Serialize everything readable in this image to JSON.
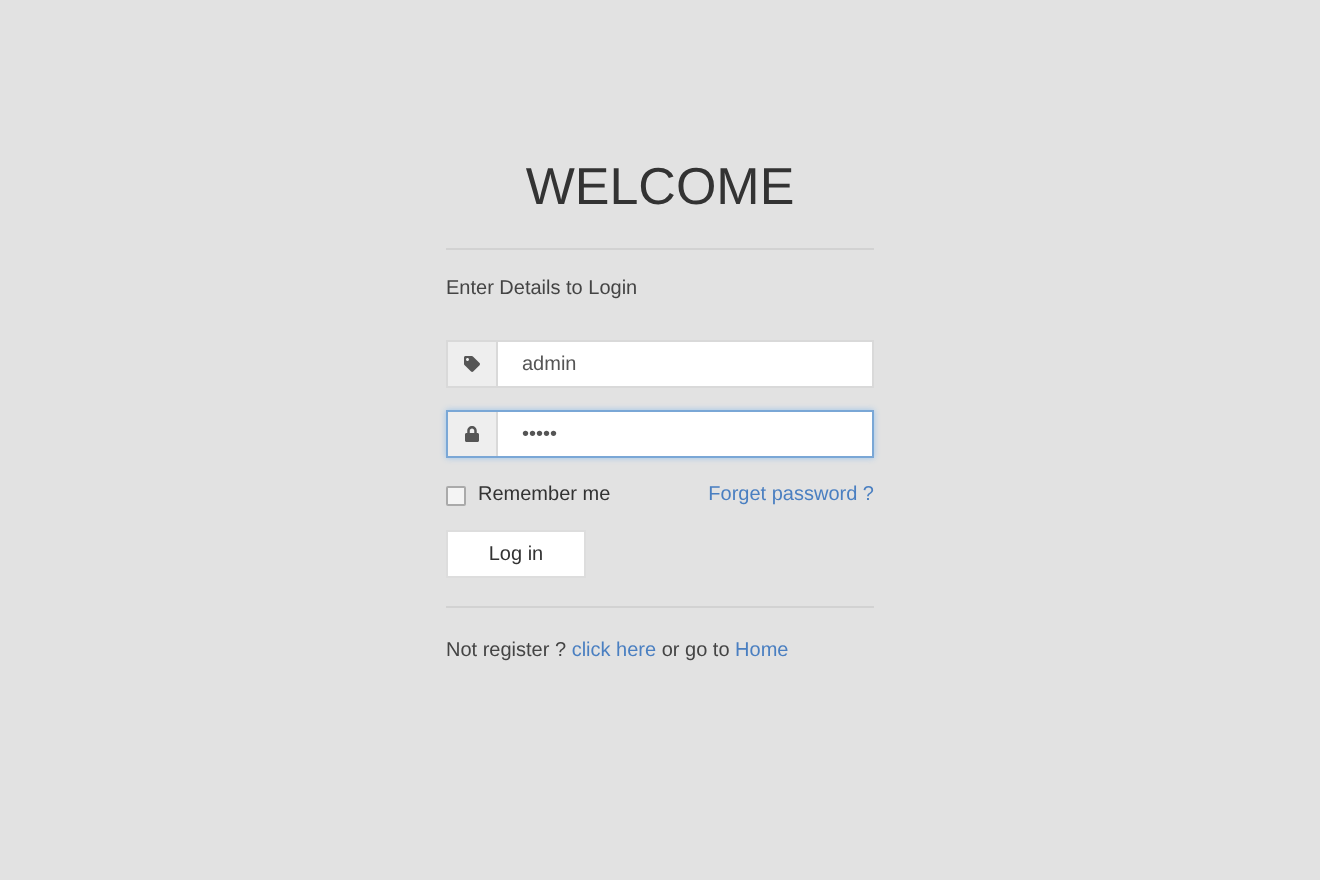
{
  "title": "WELCOME",
  "subtitle": "Enter Details to Login",
  "fields": [
    {
      "kind": "username",
      "value": "admin",
      "focused": false
    },
    {
      "kind": "password",
      "value": "•••••",
      "focused": true
    }
  ],
  "remember": {
    "label": "Remember me",
    "checked": false
  },
  "forgot_link": "Forget password ?",
  "login_button": "Log in",
  "footer": {
    "before": "Not register ? ",
    "link": "click here",
    "middle": " or go to ",
    "home_link": "Home"
  }
}
